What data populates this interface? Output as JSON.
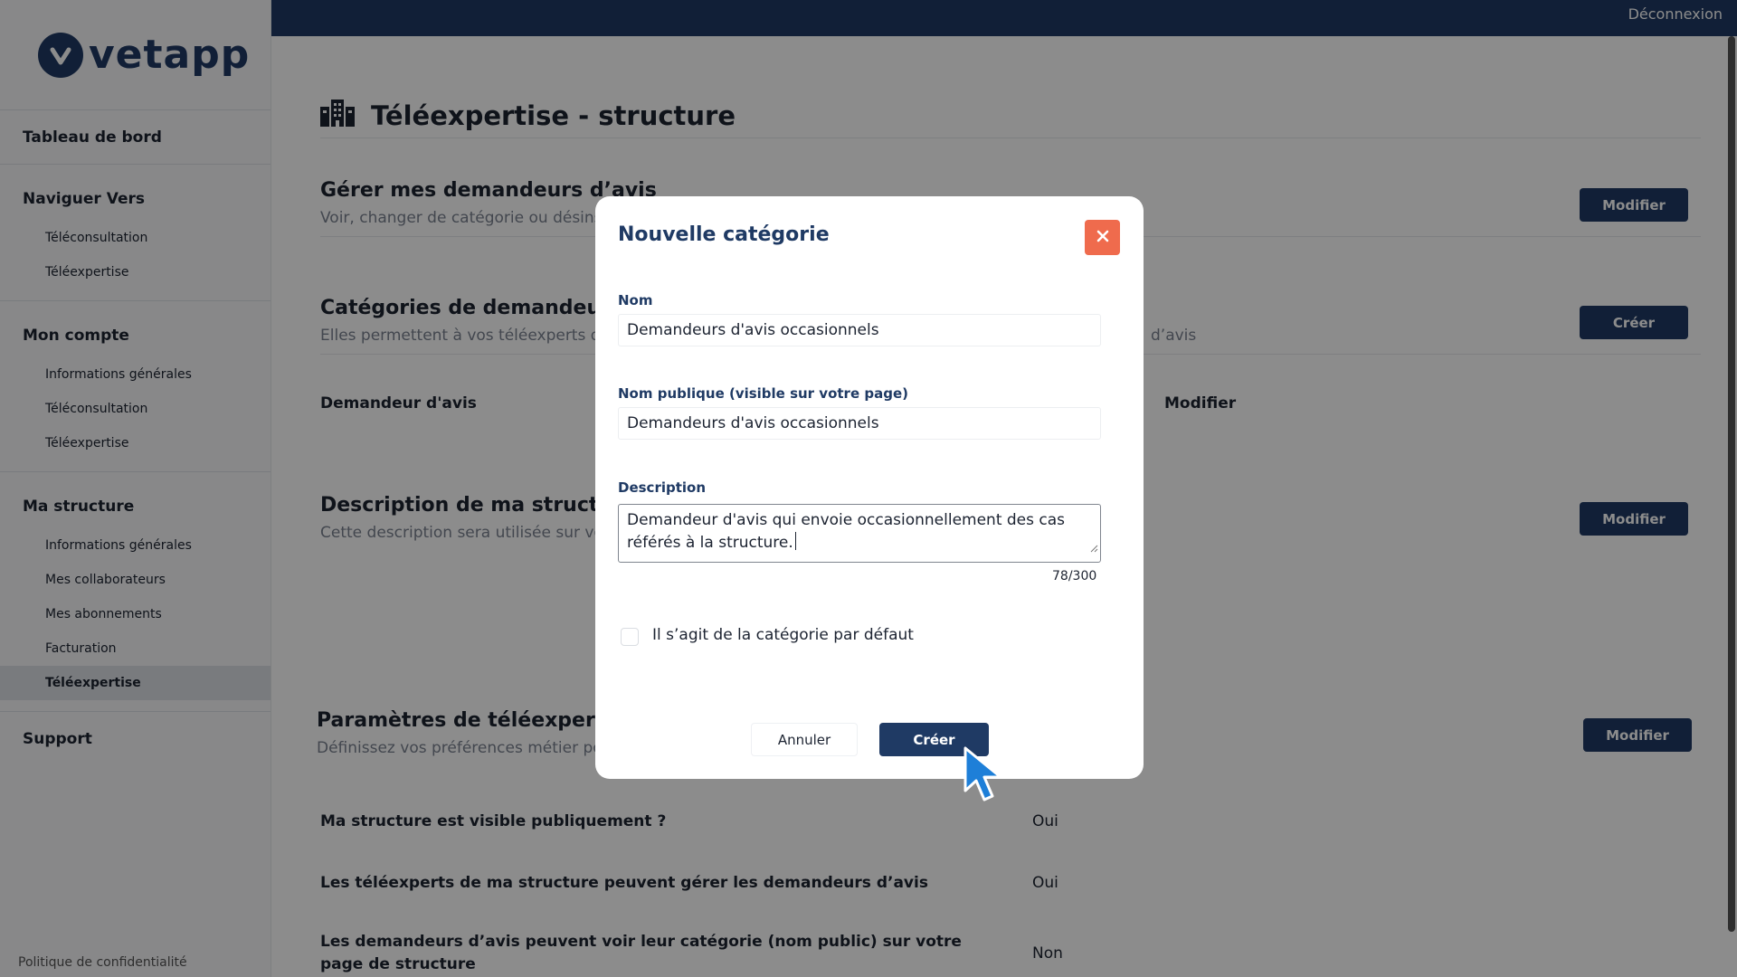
{
  "app": {
    "logo_text": "vetapp"
  },
  "topbar": {
    "logout_label": "Déconnexion"
  },
  "sidebar": {
    "dashboard": "Tableau de bord",
    "sections": [
      {
        "title": "Naviguer Vers",
        "items": [
          "Téléconsultation",
          "Téléexpertise"
        ]
      },
      {
        "title": "Mon compte",
        "items": [
          "Informations générales",
          "Téléconsultation",
          "Téléexpertise"
        ]
      },
      {
        "title": "Ma structure",
        "items": [
          "Informations générales",
          "Mes collaborateurs",
          "Mes abonnements",
          "Facturation",
          "Téléexpertise"
        ],
        "active_index": 4
      }
    ],
    "support": "Support",
    "privacy": "Politique de confidentialité"
  },
  "main": {
    "page_title": "Téléexpertise - structure",
    "sections": {
      "manage": {
        "title": "Gérer mes demandeurs d’avis",
        "subtitle": "Voir, changer de catégorie ou désins",
        "button": "Modifier"
      },
      "categories": {
        "title": "Catégories de demandeurs",
        "subtitle_left": "Elles permettent à vos téléexperts de",
        "subtitle_right": "d’avis",
        "button": "Créer",
        "row_name": "Demandeur d'avis",
        "row_action": "Modifier"
      },
      "description": {
        "title": "Description de ma structure",
        "subtitle": "Cette description sera utilisée sur vo",
        "button": "Modifier"
      },
      "params": {
        "title": "Paramètres de téléexpertise",
        "subtitle": "Définissez vos préférences métier po",
        "button": "Modifier"
      }
    },
    "settings": [
      {
        "label": "Ma structure est visible publiquement ?",
        "value": "Oui"
      },
      {
        "label": "Les téléexperts de ma structure peuvent gérer les demandeurs d’avis",
        "value": "Oui"
      },
      {
        "label": "Les demandeurs d’avis peuvent voir leur catégorie (nom public) sur votre page de structure",
        "value": "Non"
      }
    ]
  },
  "modal": {
    "title": "Nouvelle catégorie",
    "name_label": "Nom",
    "name_value": "Demandeurs d'avis occasionnels",
    "public_name_label": "Nom publique (visible sur votre page)",
    "public_name_value": "Demandeurs d'avis occasionnels",
    "description_label": "Description",
    "description_value": "Demandeur d'avis qui envoie occasionnellement des cas référés à la structure.",
    "counter": "78/300",
    "default_checkbox_label": "Il s’agit de la catégorie par défaut",
    "default_checked": false,
    "cancel_label": "Annuler",
    "create_label": "Créer"
  },
  "colors": {
    "brand": "#1f3a64",
    "close": "#ef6b4d",
    "cursor": "#1e7fd8"
  }
}
